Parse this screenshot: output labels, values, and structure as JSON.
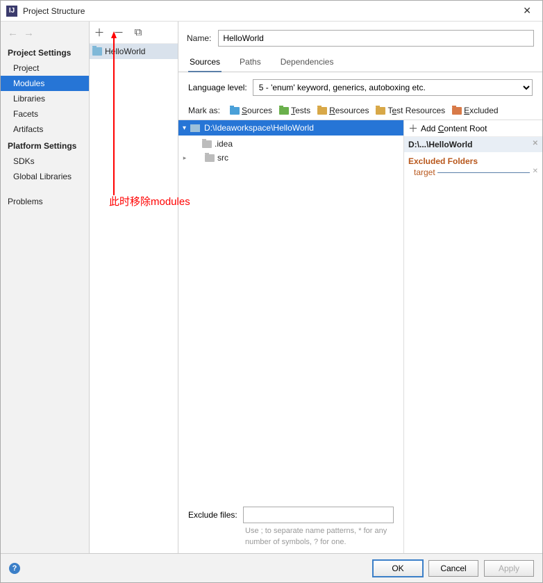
{
  "window": {
    "title": "Project Structure"
  },
  "leftnav": {
    "heading1": "Project Settings",
    "items1": [
      "Project",
      "Modules",
      "Libraries",
      "Facets",
      "Artifacts"
    ],
    "selected1": 1,
    "heading2": "Platform Settings",
    "items2": [
      "SDKs",
      "Global Libraries"
    ],
    "heading3": "",
    "items3": [
      "Problems"
    ]
  },
  "modules": {
    "items": [
      "HelloWorld"
    ]
  },
  "detail": {
    "name_label": "Name:",
    "name_value": "HelloWorld",
    "tabs": [
      "Sources",
      "Paths",
      "Dependencies"
    ],
    "active_tab": 0,
    "language_label": "Language level:",
    "language_value": "5 - 'enum' keyword, generics, autoboxing etc.",
    "mark_label": "Mark as:",
    "mark_buttons": [
      {
        "label": "Sources",
        "color": "#4aa0d8",
        "ul": "S"
      },
      {
        "label": "Tests",
        "color": "#6ab04c",
        "ul": "T"
      },
      {
        "label": "Resources",
        "color": "#d8a848",
        "ul": "R"
      },
      {
        "label": "Test Resources",
        "color": "#d8a848",
        "ul": ""
      },
      {
        "label": "Excluded",
        "color": "#d87a48",
        "ul": "E"
      }
    ],
    "tree": {
      "root": "D:\\Ideaworkspace\\HelloWorld",
      "children": [
        {
          "name": ".idea",
          "expandable": false
        },
        {
          "name": "src",
          "expandable": true
        }
      ]
    },
    "exclude_label": "Exclude files:",
    "exclude_hint": "Use ; to separate name patterns, * for any number of symbols, ? for one.",
    "right": {
      "add_root": "Add Content Root",
      "root_path": "D:\\...\\HelloWorld",
      "excluded_header": "Excluded Folders",
      "excluded_items": [
        "target"
      ]
    }
  },
  "footer": {
    "ok": "OK",
    "cancel": "Cancel",
    "apply": "Apply"
  },
  "annotation": {
    "text": "此时移除modules"
  }
}
